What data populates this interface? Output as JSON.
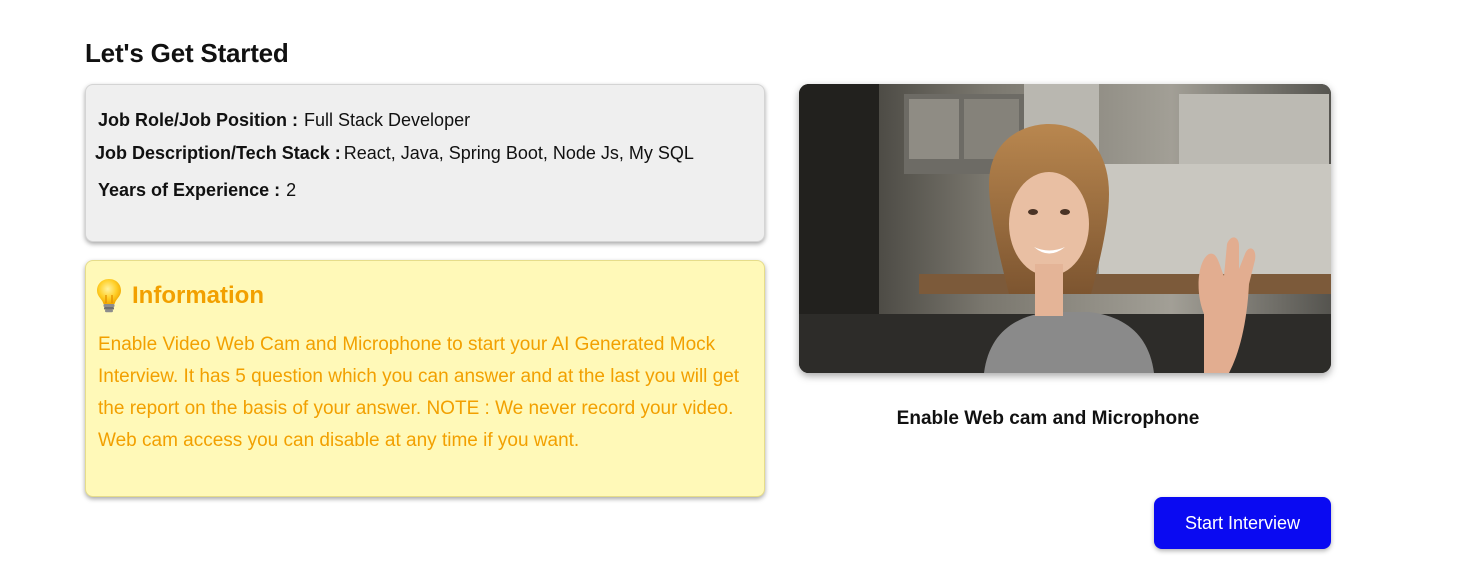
{
  "page": {
    "title": "Let's Get Started"
  },
  "job_details": {
    "role_label": "Job Role/Job Position :",
    "role_value": "Full Stack Developer",
    "description_label": "Job Description/Tech Stack :",
    "description_value": "React, Java, Spring Boot, Node Js, My SQL",
    "experience_label": "Years of Experience :",
    "experience_value": "2"
  },
  "information": {
    "icon": "lightbulb-icon",
    "title": "Information",
    "text": "Enable Video Web Cam and Microphone to start your AI Generated Mock Interview. It has 5 question which you can answer and at the last you will get the report on the basis of your answer. NOTE : We never record your video. Web cam access you can disable at any time if you want."
  },
  "webcam": {
    "caption": "Enable Web cam and Microphone"
  },
  "actions": {
    "start_label": "Start Interview"
  },
  "colors": {
    "accent": "#0a0af2",
    "info_text": "#f2a000",
    "info_bg": "#fff9b8",
    "card_bg": "#efefef"
  }
}
